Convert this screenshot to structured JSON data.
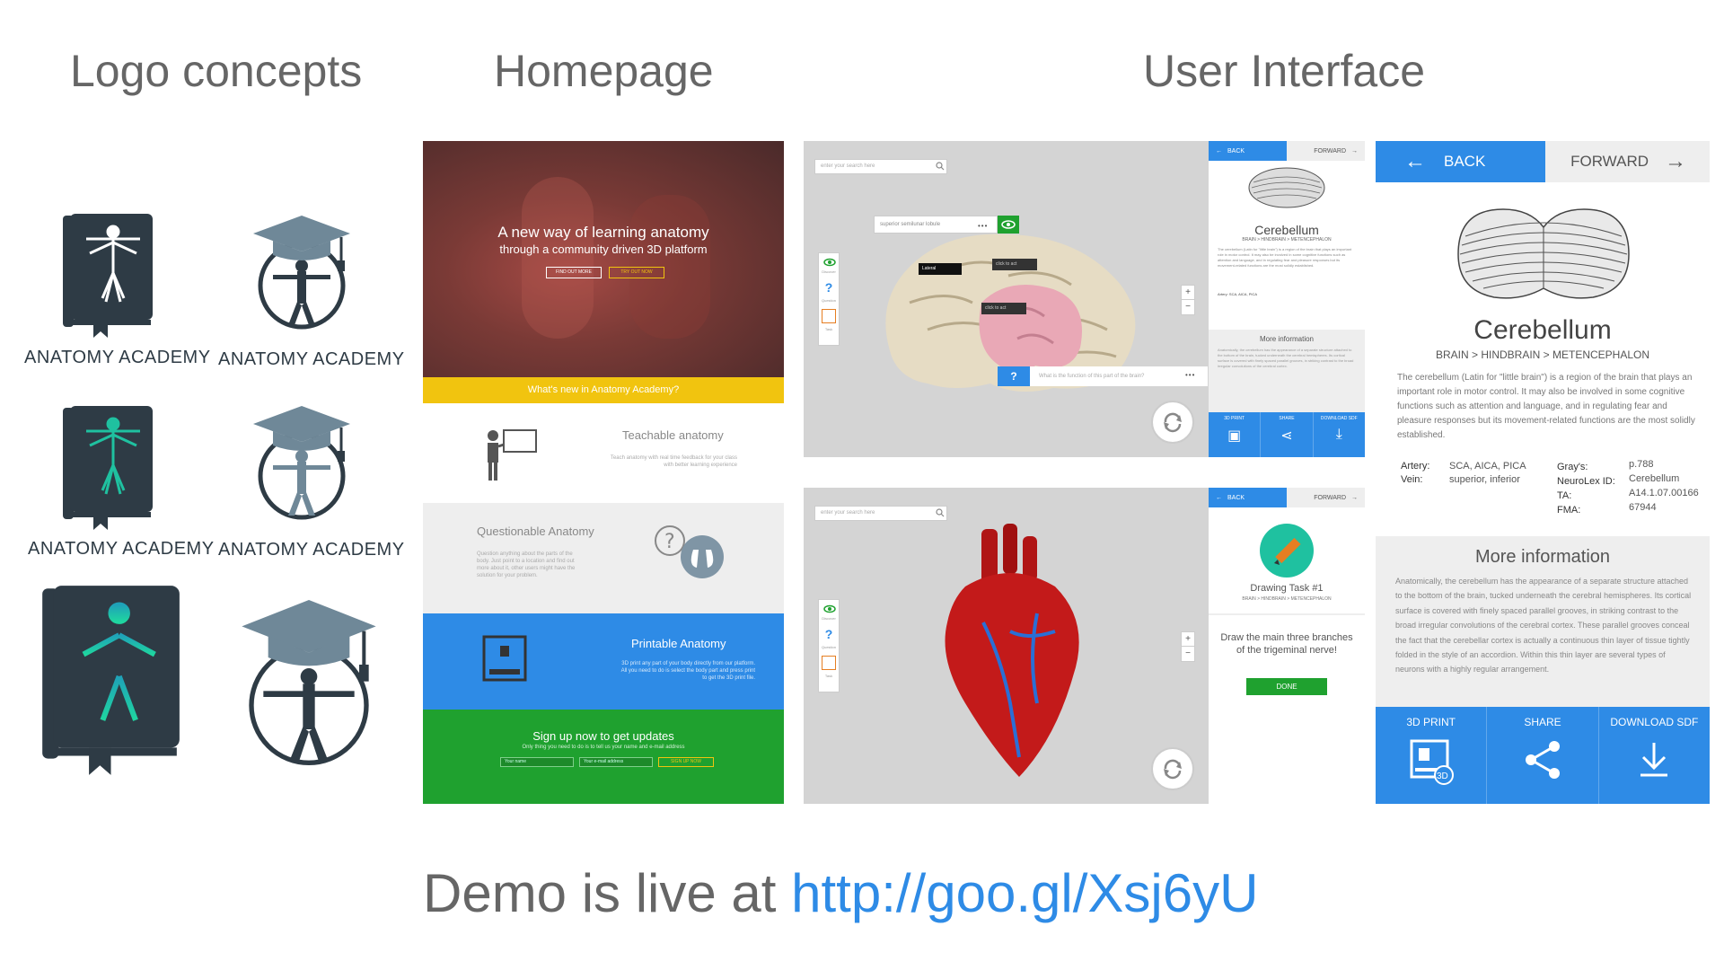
{
  "headings": {
    "logo": "Logo concepts",
    "homepage": "Homepage",
    "ui": "User Interface"
  },
  "logos": {
    "label1": "ANATOMY ACADEMY",
    "label2": "ANATOMY ACADEMY",
    "label3": "ANATOMY ACADEMY",
    "label4": "ANATOMY ACADEMY"
  },
  "homepage": {
    "hero_line1": "A new way of learning anatomy",
    "hero_line2": "through a community driven 3D platform",
    "btn_find": "FIND OUT MORE",
    "btn_try": "TRY OUT NOW",
    "whats_new": "What's new in Anatomy Academy?",
    "teachable_title": "Teachable anatomy",
    "teachable_text": "Teach anatomy with real time feedback for your class with better learning experience",
    "questionable_title": "Questionable Anatomy",
    "questionable_text": "Question anything about the parts of the body. Just point to a location and find out more about it, other users might have the solution for your problem.",
    "printable_title": "Printable Anatomy",
    "printable_text": "3D print any part of your body directly from our platform. All you need to do is select the body part and press print to get the 3D print file.",
    "signup_title": "Sign up now to get updates",
    "signup_text": "Only thing you need to do is to tell us your name and e-mail address",
    "name_ph": "Your name",
    "email_ph": "Your e-mail address",
    "signup_btn": "SIGN UP NOW"
  },
  "ui1": {
    "search_ph": "enter your search here",
    "label_superior": "superior semilunar lobule",
    "label_lateral": "Lateral",
    "label_click1": "click to act",
    "label_click2": "click to act",
    "tool_discover": "Discover",
    "tool_question": "Question",
    "tool_task": "Task",
    "question_ph": "What is the function of this part of the brain?",
    "back": "BACK",
    "forward": "FORWARD",
    "name": "Cerebellum",
    "path": "BRAIN > HINDBRAIN > METENCEPHALON",
    "desc": "The cerebellum (Latin for \"little brain\") is a region of the brain that plays an important role in motor control. It may also be involved in some cognitive functions such as attention and language, and in regulating fear and pleasure responses but its movement-related functions are the most solidly established.",
    "more_info": "More information",
    "more_text": "Anatomically, the cerebellum has the appearance of a separate structure attached to the bottom of the brain, tucked underneath the cerebral hemispheres. Its cortical surface is covered with finely spaced parallel grooves, in striking contrast to the broad irregular convolutions of the cerebral cortex.",
    "print": "3D PRINT",
    "share": "SHARE",
    "download": "DOWNLOAD SDF"
  },
  "ui2": {
    "search_ph": "enter your search here",
    "tool_discover": "Discover",
    "tool_question": "Question",
    "tool_task": "Task",
    "back": "BACK",
    "forward": "FORWARD",
    "task_title": "Drawing Task",
    "task_num": "#1",
    "task_path": "BRAIN > HINDBRAIN > METENCEPHALON",
    "task_text": "Draw the main three branches of the trigeminal nerve!",
    "done": "DONE"
  },
  "big": {
    "back": "BACK",
    "forward": "FORWARD",
    "name": "Cerebellum",
    "path": "BRAIN > HINDBRAIN > METENCEPHALON",
    "desc": "The cerebellum (Latin for \"little brain\") is a region of the brain that plays an important role in motor control. It may also be involved in some cognitive functions such as attention and language, and in regulating fear and pleasure responses but its movement-related functions are the most solidly established.",
    "artery_k": "Artery:",
    "artery_v": "SCA, AICA, PICA",
    "vein_k": "Vein:",
    "vein_v": "superior, inferior",
    "grays_k": "Gray's:",
    "grays_v": "p.788",
    "neurolex_k": "NeuroLex ID:",
    "neurolex_v": "Cerebellum",
    "ta_k": "TA:",
    "ta_v": "A14.1.07.00166",
    "fma_k": "FMA:",
    "fma_v": "67944",
    "more_info": "More information",
    "more_text": "Anatomically, the cerebellum has the appearance of a separate structure attached to the bottom of the brain, tucked underneath the cerebral hemispheres. Its cortical surface is covered with finely spaced parallel grooves, in striking contrast to the broad irregular convolutions of the cerebral cortex. These parallel grooves conceal the fact that the cerebellar cortex is actually a continuous thin layer of tissue tightly folded in the style of an accordion. Within this thin layer are several types of neurons with a highly regular arrangement.",
    "print": "3D PRINT",
    "share": "SHARE",
    "download": "DOWNLOAD SDF"
  },
  "demo": {
    "prefix": "Demo is live at",
    "link": "http://goo.gl/Xsj6yU"
  },
  "colors": {
    "blue": "#2e8be6",
    "green": "#1fa12f",
    "yellow": "#f1c40f",
    "dark": "#2e3b45",
    "teal": "#1fc1a0"
  }
}
